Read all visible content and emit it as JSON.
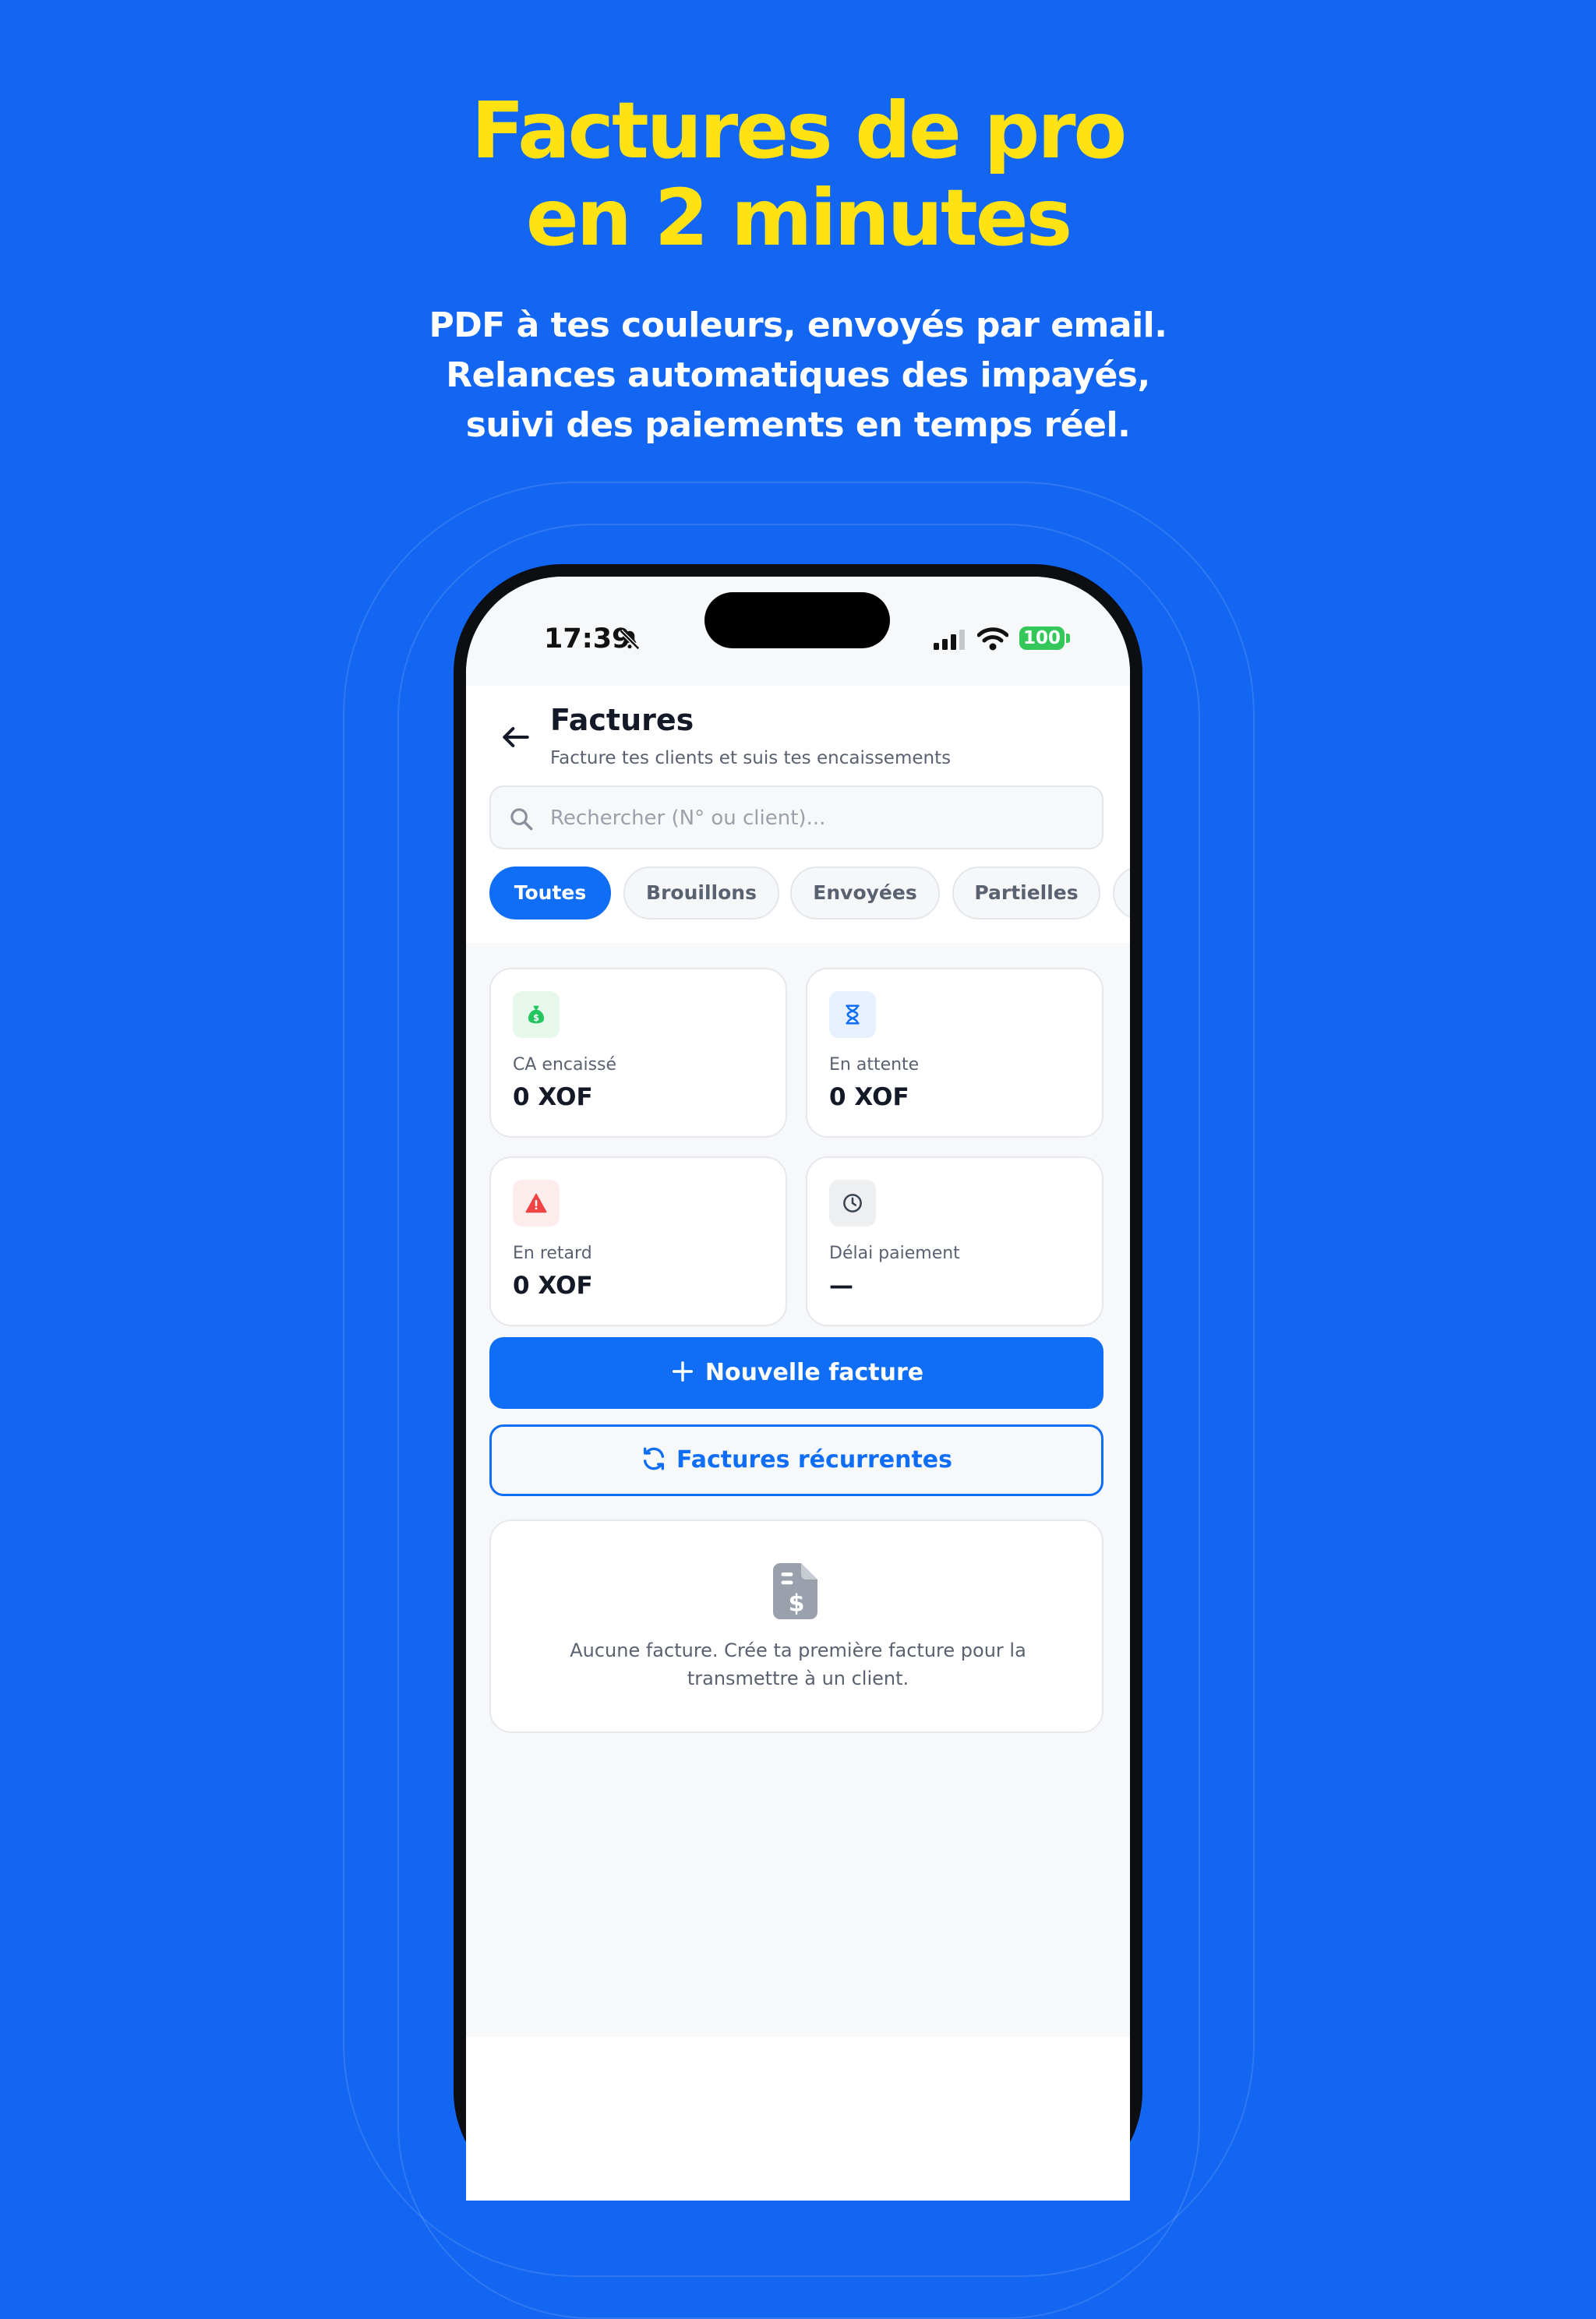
{
  "marketing": {
    "headline_line1": "Factures de pro",
    "headline_line2": "en 2 minutes",
    "subtitle_line1": "PDF à tes couleurs, envoyés par email.",
    "subtitle_line2": "Relances automatiques des impayés,",
    "subtitle_line3": "suivi des paiements en temps réel."
  },
  "status_bar": {
    "time": "17:39",
    "battery": "100"
  },
  "header": {
    "title": "Factures",
    "subtitle": "Facture tes clients et suis tes encaissements"
  },
  "search": {
    "placeholder": "Rechercher (N° ou client)..."
  },
  "filters": [
    "Toutes",
    "Brouillons",
    "Envoyées",
    "Partielles"
  ],
  "active_filter": "Toutes",
  "stats": [
    {
      "label": "CA encaissé",
      "value": "0 XOF",
      "icon": "money-bag-icon"
    },
    {
      "label": "En attente",
      "value": "0 XOF",
      "icon": "hourglass-icon"
    },
    {
      "label": "En retard",
      "value": "0 XOF",
      "icon": "warning-icon"
    },
    {
      "label": "Délai paiement",
      "value": "—",
      "icon": "clock-icon"
    }
  ],
  "actions": {
    "new_invoice": "Nouvelle facture",
    "recurring": "Factures récurrentes"
  },
  "empty_state": {
    "line1": "Aucune facture. Crée ta première facture pour la",
    "line2": "transmettre à un client."
  },
  "colors": {
    "background": "#1366F2",
    "headline": "#FFE214",
    "accent": "#0F6EF5",
    "success": "#22C55E",
    "danger": "#EF4444"
  }
}
